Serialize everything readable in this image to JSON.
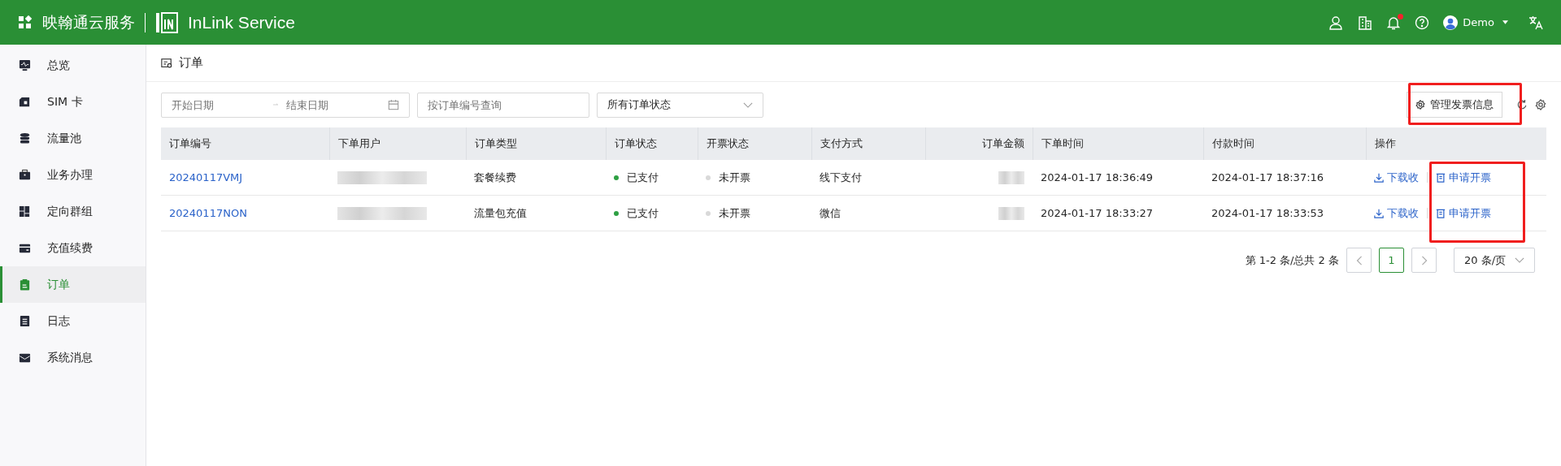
{
  "header": {
    "brand": "映翰通云服务",
    "product": "InLink Service",
    "user": "Demo",
    "notification_badge": true
  },
  "sidebar": {
    "items": [
      {
        "label": "总览",
        "selected": false
      },
      {
        "label": "SIM 卡",
        "selected": false
      },
      {
        "label": "流量池",
        "selected": false
      },
      {
        "label": "业务办理",
        "selected": false
      },
      {
        "label": "定向群组",
        "selected": false
      },
      {
        "label": "充值续费",
        "selected": false
      },
      {
        "label": "订单",
        "selected": true
      },
      {
        "label": "日志",
        "selected": false
      },
      {
        "label": "系统消息",
        "selected": false
      }
    ]
  },
  "page": {
    "title": "订单"
  },
  "filters": {
    "start_date": {
      "placeholder": "开始日期"
    },
    "end_date": {
      "placeholder": "结束日期"
    },
    "search": {
      "placeholder": "按订单编号查询"
    },
    "status": {
      "value": "所有订单状态"
    },
    "manage_button": "管理发票信息"
  },
  "table": {
    "columns": [
      "订单编号",
      "下单用户",
      "订单类型",
      "订单状态",
      "开票状态",
      "支付方式",
      "订单金额",
      "下单时间",
      "付款时间",
      "操作"
    ],
    "rows": [
      {
        "order_no": "20240117VMJ",
        "type": "套餐续费",
        "order_status": {
          "label": "已支付",
          "color": "#2ea043"
        },
        "invoice_status": {
          "label": "未开票",
          "color": "#d9d9d9"
        },
        "payment": "线下支付",
        "created": "2024-01-17 18:36:49",
        "paid": "2024-01-17 18:37:16",
        "actions": [
          "下载收",
          "申请开票"
        ]
      },
      {
        "order_no": "20240117NON",
        "type": "流量包充值",
        "order_status": {
          "label": "已支付",
          "color": "#2ea043"
        },
        "invoice_status": {
          "label": "未开票",
          "color": "#d9d9d9"
        },
        "payment": "微信",
        "created": "2024-01-17 18:33:27",
        "paid": "2024-01-17 18:33:53",
        "actions": [
          "下载收",
          "申请开票"
        ]
      }
    ]
  },
  "pagination": {
    "summary": "第 1-2 条/总共 2 条",
    "pages": [
      {
        "label": "1",
        "selected": true
      }
    ],
    "page_size": "20 条/页"
  }
}
